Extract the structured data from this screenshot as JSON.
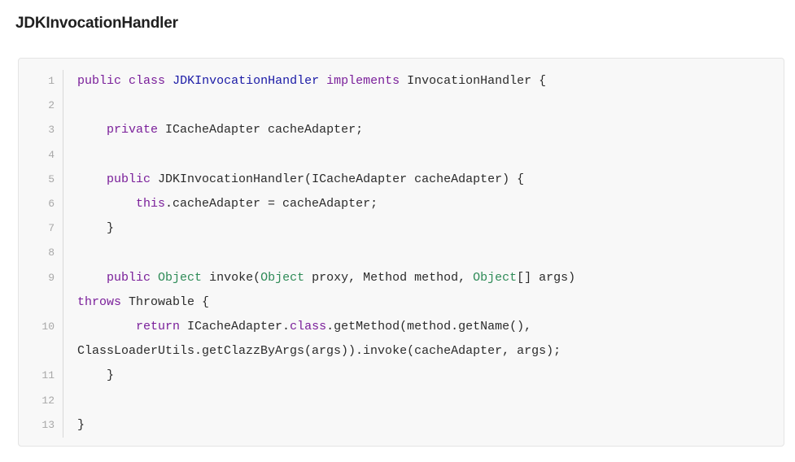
{
  "heading": "JDKInvocationHandler",
  "code": {
    "lines": [
      {
        "num": "1",
        "tokens": [
          {
            "t": "public",
            "c": "kw"
          },
          {
            "t": " ",
            "c": ""
          },
          {
            "t": "class",
            "c": "kw"
          },
          {
            "t": " ",
            "c": ""
          },
          {
            "t": "JDKInvocationHandler",
            "c": "nm"
          },
          {
            "t": " ",
            "c": ""
          },
          {
            "t": "implements",
            "c": "kw"
          },
          {
            "t": " InvocationHandler {",
            "c": ""
          }
        ]
      },
      {
        "num": "2",
        "tokens": []
      },
      {
        "num": "3",
        "tokens": [
          {
            "t": "    ",
            "c": ""
          },
          {
            "t": "private",
            "c": "kw"
          },
          {
            "t": " ICacheAdapter cacheAdapter;",
            "c": ""
          }
        ]
      },
      {
        "num": "4",
        "tokens": []
      },
      {
        "num": "5",
        "tokens": [
          {
            "t": "    ",
            "c": ""
          },
          {
            "t": "public",
            "c": "kw"
          },
          {
            "t": " JDKInvocationHandler(ICacheAdapter cacheAdapter) {",
            "c": ""
          }
        ]
      },
      {
        "num": "6",
        "tokens": [
          {
            "t": "        ",
            "c": ""
          },
          {
            "t": "this",
            "c": "kw"
          },
          {
            "t": ".cacheAdapter = cacheAdapter;",
            "c": ""
          }
        ]
      },
      {
        "num": "7",
        "tokens": [
          {
            "t": "    }",
            "c": ""
          }
        ]
      },
      {
        "num": "8",
        "tokens": []
      },
      {
        "num": "9",
        "tokens": [
          {
            "t": "    ",
            "c": ""
          },
          {
            "t": "public",
            "c": "kw"
          },
          {
            "t": " ",
            "c": ""
          },
          {
            "t": "Object",
            "c": "ty"
          },
          {
            "t": " invoke(",
            "c": ""
          },
          {
            "t": "Object",
            "c": "ty"
          },
          {
            "t": " proxy, Method method, ",
            "c": ""
          },
          {
            "t": "Object",
            "c": "ty"
          },
          {
            "t": "[] args)",
            "c": ""
          }
        ]
      },
      {
        "num": "",
        "tokens": [
          {
            "t": "throws",
            "c": "kw"
          },
          {
            "t": " Throwable {",
            "c": ""
          }
        ]
      },
      {
        "num": "10",
        "tokens": [
          {
            "t": "        ",
            "c": ""
          },
          {
            "t": "return",
            "c": "kw"
          },
          {
            "t": " ICacheAdapter.",
            "c": ""
          },
          {
            "t": "class",
            "c": "cl"
          },
          {
            "t": ".getMethod(method.getName(),",
            "c": ""
          }
        ]
      },
      {
        "num": "",
        "tokens": [
          {
            "t": "ClassLoaderUtils.getClazzByArgs(args)).invoke(cacheAdapter, args);",
            "c": ""
          }
        ]
      },
      {
        "num": "11",
        "tokens": [
          {
            "t": "    }",
            "c": ""
          }
        ]
      },
      {
        "num": "12",
        "tokens": []
      },
      {
        "num": "13",
        "tokens": [
          {
            "t": "}",
            "c": ""
          }
        ]
      }
    ],
    "colors": {
      "keyword": "#7a1f9a",
      "type": "#2e8b57",
      "class_name": "#1a1aa6",
      "text": "#2b2b2b",
      "line_number": "#a8a8a8",
      "background": "#f8f8f8"
    }
  }
}
